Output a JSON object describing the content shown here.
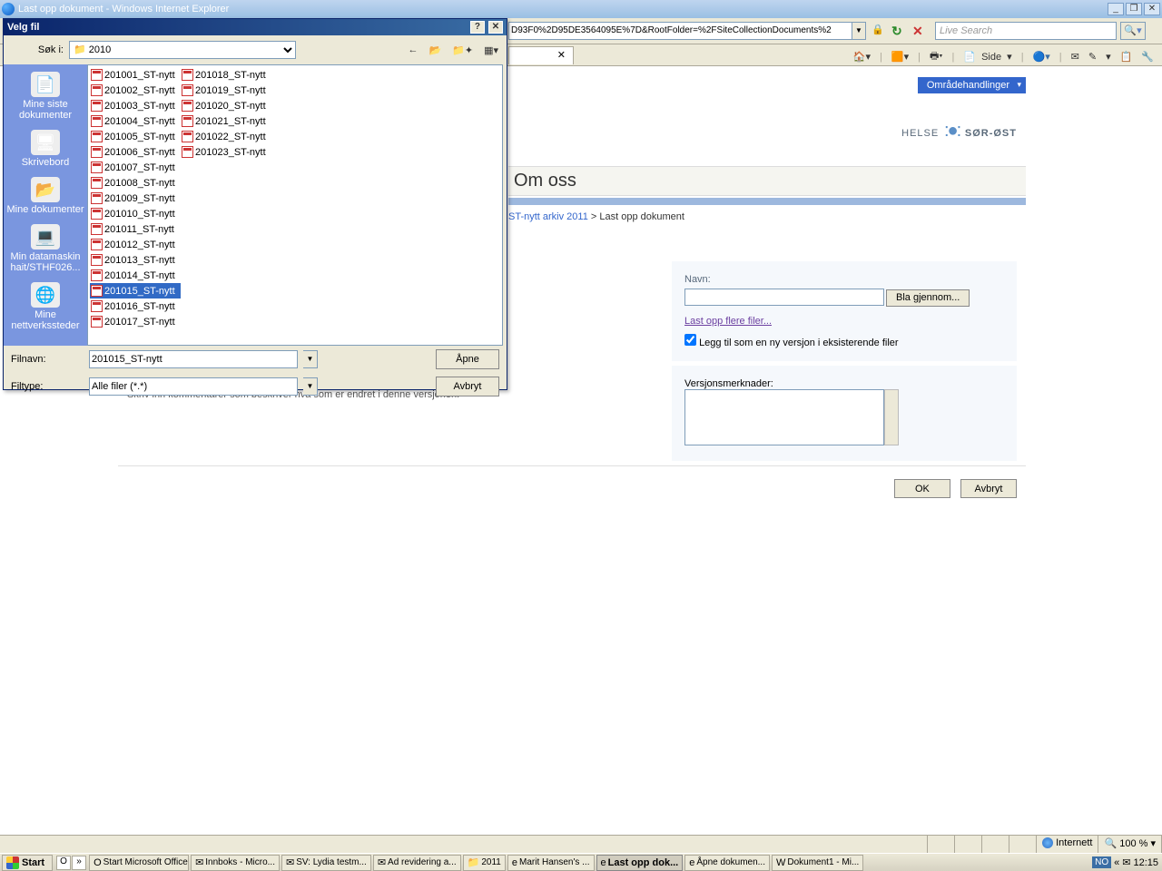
{
  "window": {
    "title": "Last opp dokument - Windows Internet Explorer"
  },
  "address": "D93F0%2D95DE3564095E%7D&RootFolder=%2FSiteCollectionDocuments%2",
  "search_placeholder": "Live Search",
  "tab_close": "✕",
  "toolbar": {
    "side": "Side",
    "home": "⌂",
    "rss": "▦",
    "print": "⎙",
    "help": "?"
  },
  "actions": "Områdehandlinger",
  "logo_a": "HELSE",
  "logo_b": "SØR-ØST",
  "om_oss": "Om oss",
  "crumb_link": "ST-nytt arkiv 2011",
  "crumb_sep": " > ",
  "crumb_cur": "Last opp dokument",
  "form": {
    "name_label": "Navn:",
    "browse": "Bla gjennom...",
    "multi": "Last opp flere filer...",
    "addver": "Legg til som en ny versjon i eksisterende filer"
  },
  "vers": {
    "title": "Versjonsmerknader",
    "desc": "Skriv inn kommentarer som beskriver hva som er endret i denne versjonen.",
    "label": "Versjonsmerknader:"
  },
  "buttons": {
    "ok": "OK",
    "cancel": "Avbryt"
  },
  "dialog": {
    "title": "Velg fil",
    "look_label": "Søk i:",
    "folder": "2010",
    "places": [
      {
        "icon": "📄",
        "label": "Mine siste dokumenter"
      },
      {
        "icon": "🖥",
        "label": "Skrivebord"
      },
      {
        "icon": "📂",
        "label": "Mine dokumenter"
      },
      {
        "icon": "💻",
        "label": "Min datamaskin hait/STHF026..."
      },
      {
        "icon": "🌐",
        "label": "Mine nettverkssteder"
      }
    ],
    "files": [
      "201001_ST-nytt",
      "201002_ST-nytt",
      "201003_ST-nytt",
      "201004_ST-nytt",
      "201005_ST-nytt",
      "201006_ST-nytt",
      "201007_ST-nytt",
      "201008_ST-nytt",
      "201009_ST-nytt",
      "201010_ST-nytt",
      "201011_ST-nytt",
      "201012_ST-nytt",
      "201013_ST-nytt",
      "201014_ST-nytt",
      "201015_ST-nytt",
      "201016_ST-nytt",
      "201017_ST-nytt",
      "201018_ST-nytt",
      "201019_ST-nytt",
      "201020_ST-nytt",
      "201021_ST-nytt",
      "201022_ST-nytt",
      "201023_ST-nytt"
    ],
    "selected_index": 14,
    "filename_label": "Filnavn:",
    "filename": "201015_ST-nytt",
    "filetype_label": "Filtype:",
    "filetype": "Alle filer (*.*)",
    "open": "Åpne",
    "cancel": "Avbryt"
  },
  "status": {
    "zone": "Internett",
    "zoom": "100 %"
  },
  "taskbar": {
    "start": "Start",
    "ql": [
      "O",
      "»"
    ],
    "items": [
      {
        "icon": "O",
        "label": "Start Microsoft Office",
        "active": false
      },
      {
        "icon": "✉",
        "label": "Innboks - Micro...",
        "active": false
      },
      {
        "icon": "✉",
        "label": "SV: Lydia testm...",
        "active": false
      },
      {
        "icon": "✉",
        "label": "Ad revidering a...",
        "active": false
      },
      {
        "icon": "📁",
        "label": "2011",
        "active": false
      },
      {
        "icon": "e",
        "label": "Marit Hansen's ...",
        "active": false
      },
      {
        "icon": "e",
        "label": "Last opp dok...",
        "active": true
      },
      {
        "icon": "e",
        "label": "Åpne dokumen...",
        "active": false
      },
      {
        "icon": "W",
        "label": "Dokument1 - Mi...",
        "active": false
      }
    ],
    "lang": "NO",
    "time": "12:15"
  }
}
